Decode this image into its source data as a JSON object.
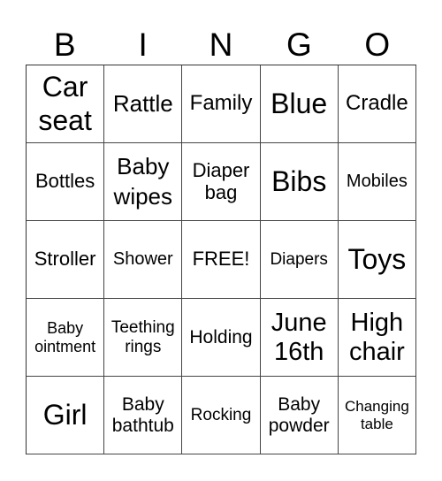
{
  "header": [
    "B",
    "I",
    "N",
    "G",
    "O"
  ],
  "cells": [
    "Car\nseat",
    "Rattle",
    "Family",
    "Blue",
    "Cradle",
    "Bottles",
    "Baby\nwipes",
    "Diaper\nbag",
    "Bibs",
    "Mobiles",
    "Stroller",
    "Shower",
    "FREE!",
    "Diapers",
    "Toys",
    "Baby\nointment",
    "Teething\nrings",
    "Holding",
    "June\n16th",
    "High\nchair",
    "Girl",
    "Baby\nbathtub",
    "Rocking",
    "Baby\npowder",
    "Changing\ntable"
  ]
}
